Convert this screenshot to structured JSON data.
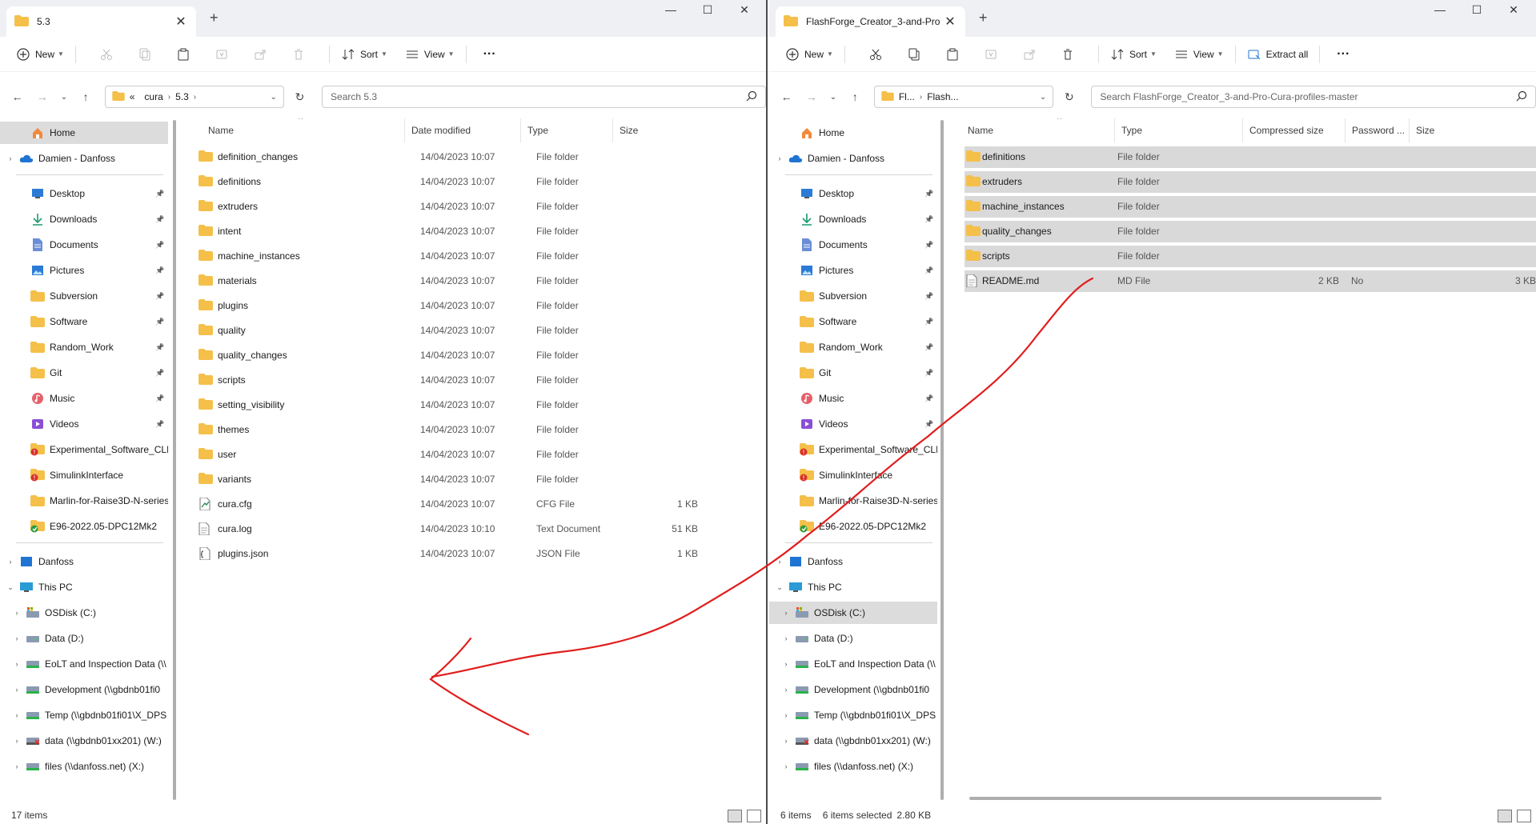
{
  "icons": {
    "folder_color": "#f4c04a",
    "onedrive_color": "#1f74d3",
    "annotation_color": "#e11d1d"
  },
  "left": {
    "tab_title": "5.3",
    "toolbar": {
      "new_label": "New",
      "sort_label": "Sort",
      "view_label": "View"
    },
    "breadcrumb": {
      "overflow": "«",
      "items": [
        "cura",
        "5.3"
      ]
    },
    "search_placeholder": "Search 5.3",
    "columns": {
      "name": "Name",
      "date": "Date modified",
      "type": "Type",
      "size": "Size"
    },
    "files": [
      {
        "name": "definition_changes",
        "date": "14/04/2023 10:07",
        "type": "File folder",
        "size": "",
        "kind": "folder"
      },
      {
        "name": "definitions",
        "date": "14/04/2023 10:07",
        "type": "File folder",
        "size": "",
        "kind": "folder"
      },
      {
        "name": "extruders",
        "date": "14/04/2023 10:07",
        "type": "File folder",
        "size": "",
        "kind": "folder"
      },
      {
        "name": "intent",
        "date": "14/04/2023 10:07",
        "type": "File folder",
        "size": "",
        "kind": "folder"
      },
      {
        "name": "machine_instances",
        "date": "14/04/2023 10:07",
        "type": "File folder",
        "size": "",
        "kind": "folder"
      },
      {
        "name": "materials",
        "date": "14/04/2023 10:07",
        "type": "File folder",
        "size": "",
        "kind": "folder"
      },
      {
        "name": "plugins",
        "date": "14/04/2023 10:07",
        "type": "File folder",
        "size": "",
        "kind": "folder"
      },
      {
        "name": "quality",
        "date": "14/04/2023 10:07",
        "type": "File folder",
        "size": "",
        "kind": "folder"
      },
      {
        "name": "quality_changes",
        "date": "14/04/2023 10:07",
        "type": "File folder",
        "size": "",
        "kind": "folder"
      },
      {
        "name": "scripts",
        "date": "14/04/2023 10:07",
        "type": "File folder",
        "size": "",
        "kind": "folder"
      },
      {
        "name": "setting_visibility",
        "date": "14/04/2023 10:07",
        "type": "File folder",
        "size": "",
        "kind": "folder"
      },
      {
        "name": "themes",
        "date": "14/04/2023 10:07",
        "type": "File folder",
        "size": "",
        "kind": "folder"
      },
      {
        "name": "user",
        "date": "14/04/2023 10:07",
        "type": "File folder",
        "size": "",
        "kind": "folder"
      },
      {
        "name": "variants",
        "date": "14/04/2023 10:07",
        "type": "File folder",
        "size": "",
        "kind": "folder"
      },
      {
        "name": "cura.cfg",
        "date": "14/04/2023 10:07",
        "type": "CFG File",
        "size": "1 KB",
        "kind": "cfg"
      },
      {
        "name": "cura.log",
        "date": "14/04/2023 10:10",
        "type": "Text Document",
        "size": "51 KB",
        "kind": "text"
      },
      {
        "name": "plugins.json",
        "date": "14/04/2023 10:07",
        "type": "JSON File",
        "size": "1 KB",
        "kind": "json"
      }
    ],
    "status": {
      "count": "17 items"
    }
  },
  "right": {
    "tab_title": "FlashForge_Creator_3-and-Pro",
    "toolbar": {
      "new_label": "New",
      "sort_label": "Sort",
      "view_label": "View",
      "extract_label": "Extract all"
    },
    "breadcrumb": {
      "items": [
        "Fl...",
        "Flash..."
      ]
    },
    "search_placeholder": "Search FlashForge_Creator_3-and-Pro-Cura-profiles-master",
    "columns": {
      "name": "Name",
      "type": "Type",
      "compressed": "Compressed size",
      "password": "Password ...",
      "size": "Size"
    },
    "files": [
      {
        "name": "definitions",
        "type": "File folder",
        "compressed": "",
        "password": "",
        "size": "",
        "kind": "folder"
      },
      {
        "name": "extruders",
        "type": "File folder",
        "compressed": "",
        "password": "",
        "size": "",
        "kind": "folder"
      },
      {
        "name": "machine_instances",
        "type": "File folder",
        "compressed": "",
        "password": "",
        "size": "",
        "kind": "folder"
      },
      {
        "name": "quality_changes",
        "type": "File folder",
        "compressed": "",
        "password": "",
        "size": "",
        "kind": "folder"
      },
      {
        "name": "scripts",
        "type": "File folder",
        "compressed": "",
        "password": "",
        "size": "",
        "kind": "folder"
      },
      {
        "name": "README.md",
        "type": "MD File",
        "compressed": "2 KB",
        "password": "No",
        "size": "3 KB",
        "kind": "text"
      }
    ],
    "status": {
      "count": "6 items",
      "selected": "6 items selected",
      "selected_size": "2.80 KB"
    }
  },
  "nav": {
    "home": "Home",
    "onedrive": "Damien - Danfoss",
    "quick": [
      {
        "label": "Desktop",
        "icon": "desktop-icon",
        "pinned": true
      },
      {
        "label": "Downloads",
        "icon": "downloads-icon",
        "pinned": true
      },
      {
        "label": "Documents",
        "icon": "documents-icon",
        "pinned": true
      },
      {
        "label": "Pictures",
        "icon": "pictures-icon",
        "pinned": true
      },
      {
        "label": "Subversion",
        "icon": "folder-icon",
        "pinned": true
      },
      {
        "label": "Software",
        "icon": "folder-icon",
        "pinned": true
      },
      {
        "label": "Random_Work",
        "icon": "folder-icon",
        "pinned": true
      },
      {
        "label": "Git",
        "icon": "folder-icon",
        "pinned": true
      },
      {
        "label": "Music",
        "icon": "music-icon",
        "pinned": true
      },
      {
        "label": "Videos",
        "icon": "videos-icon",
        "pinned": true
      },
      {
        "label": "Experimental_Software_CLEAN",
        "icon": "svn-folder-icon",
        "pinned": false
      },
      {
        "label": "SimulinkInterface",
        "icon": "svn-folder-icon",
        "pinned": false
      },
      {
        "label": "Marlin-for-Raise3D-N-series",
        "icon": "folder-icon",
        "pinned": false
      },
      {
        "label": "E96-2022.05-DPC12Mk2",
        "icon": "svn-ok-folder-icon",
        "pinned": false
      }
    ],
    "danfoss": "Danfoss",
    "thispc": "This PC",
    "drives": [
      {
        "label": "OSDisk (C:)",
        "icon": "os-drive-icon"
      },
      {
        "label": "Data (D:)",
        "icon": "drive-icon"
      },
      {
        "label": "EoLT and Inspection Data (\\\\",
        "icon": "network-drive-icon"
      },
      {
        "label": "Development (\\\\gbdnb01fi0",
        "icon": "network-drive-icon"
      },
      {
        "label": "Temp (\\\\gbdnb01fi01\\X_DPS",
        "icon": "network-drive-icon"
      },
      {
        "label": "data (\\\\gbdnb01xx201) (W:)",
        "icon": "disconnected-drive-icon"
      },
      {
        "label": "files (\\\\danfoss.net) (X:)",
        "icon": "network-drive-icon"
      }
    ]
  }
}
